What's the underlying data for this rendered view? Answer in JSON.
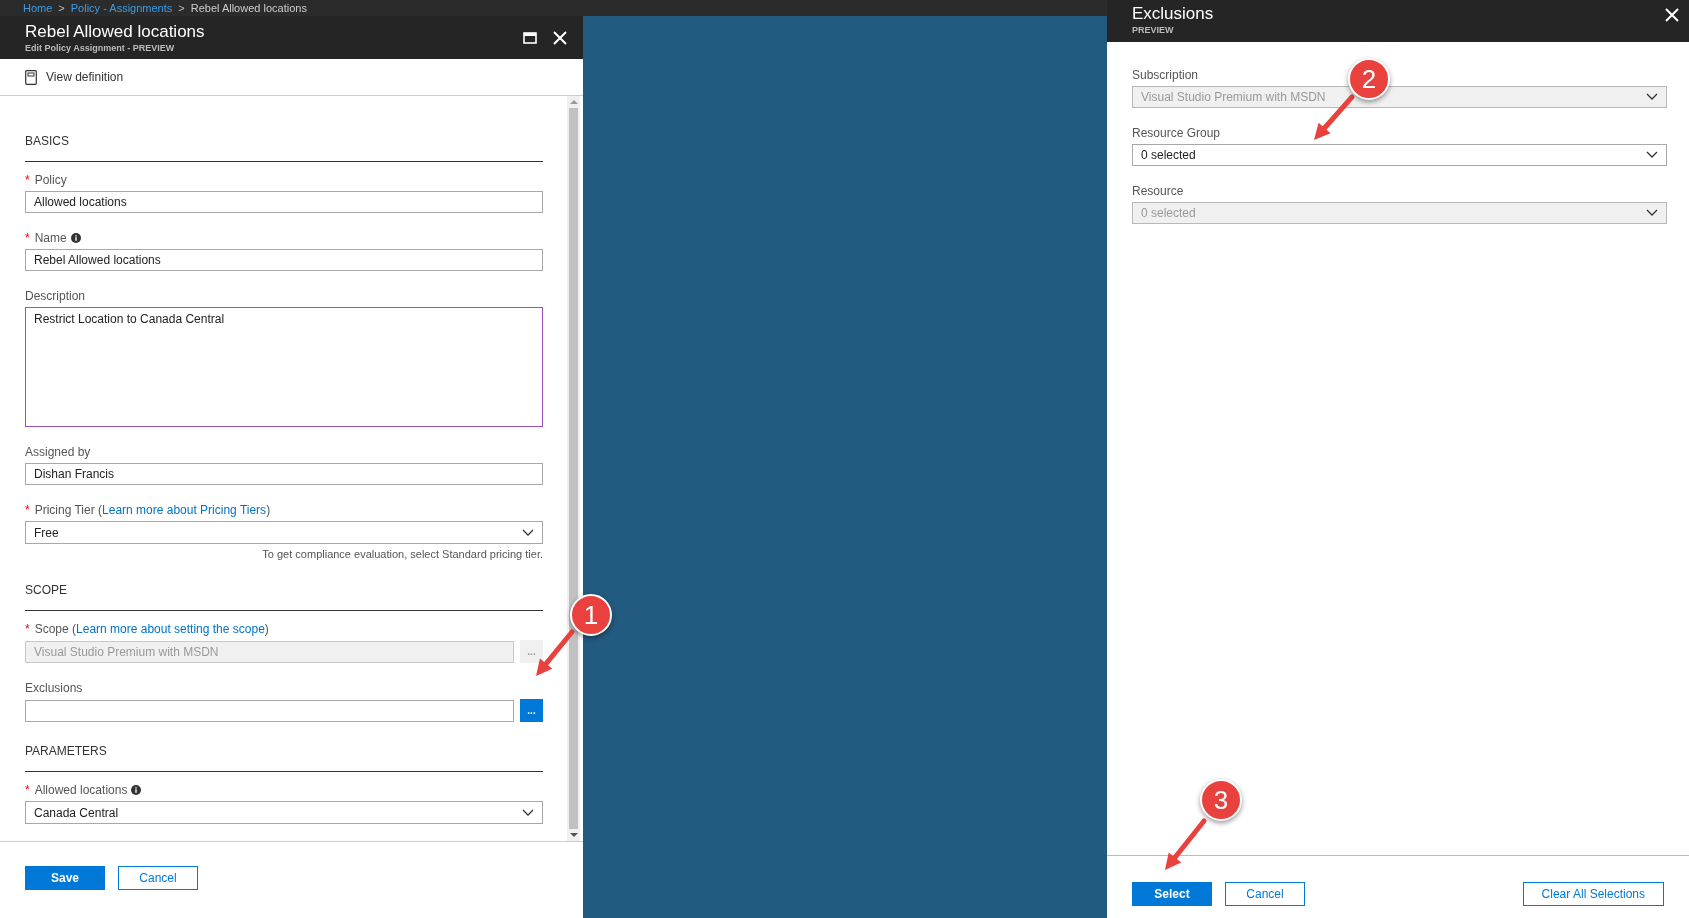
{
  "breadcrumb": [
    {
      "label": "Home",
      "link": true
    },
    {
      "label": "Policy - Assignments",
      "link": true
    },
    {
      "label": "Rebel Allowed locations",
      "link": false
    }
  ],
  "breadcrumb_separator": ">",
  "required_mark": "*",
  "blade": {
    "title": "Rebel Allowed locations",
    "subtitle": "Edit Policy Assignment - PREVIEW"
  },
  "toolbar": {
    "label": "View definition"
  },
  "sections": [
    {
      "heading": "BASICS",
      "fields": [
        {
          "kind": "text",
          "label": "Policy",
          "required": true,
          "info": false,
          "value": "Allowed locations"
        },
        {
          "kind": "text",
          "label": "Name",
          "required": true,
          "info": true,
          "value": "Rebel Allowed locations"
        },
        {
          "kind": "textarea",
          "label": "Description",
          "required": false,
          "info": false,
          "focused": true,
          "value": "Restrict Location to Canada Central"
        },
        {
          "kind": "text",
          "label": "Assigned by",
          "required": false,
          "info": false,
          "value": "Dishan Francis"
        },
        {
          "kind": "select",
          "label": "Pricing Tier (",
          "link": "Learn more about Pricing Tiers",
          "label_after": ")",
          "required": true,
          "info": false,
          "value": "Free",
          "hint": "To get compliance evaluation, select Standard pricing tier."
        }
      ]
    },
    {
      "heading": "SCOPE",
      "fields": [
        {
          "kind": "picker",
          "label": "Scope (",
          "link": "Learn more about setting the scope",
          "label_after": ")",
          "required": true,
          "info": false,
          "disabled": true,
          "value": "Visual Studio Premium with MSDN",
          "button": "..."
        },
        {
          "kind": "picker",
          "label": "Exclusions",
          "required": false,
          "info": false,
          "disabled": false,
          "button": "..."
        }
      ]
    },
    {
      "heading": "PARAMETERS",
      "fields": [
        {
          "kind": "select",
          "label": "Allowed locations",
          "required": true,
          "info": true,
          "value": "Canada Central"
        }
      ]
    }
  ],
  "footer_buttons": [
    {
      "label": "Save",
      "primary": true
    },
    {
      "label": "Cancel",
      "primary": false
    }
  ],
  "exclusions": {
    "title": "Exclusions",
    "subtitle": "PREVIEW",
    "fields": [
      {
        "label": "Subscription",
        "value": "Visual Studio Premium with MSDN",
        "disabled": true
      },
      {
        "label": "Resource Group",
        "value": "0 selected",
        "disabled": false
      },
      {
        "label": "Resource",
        "value": "0 selected",
        "disabled": true
      }
    ],
    "buttons": [
      {
        "label": "Select",
        "primary": true
      },
      {
        "label": "Cancel",
        "primary": false
      },
      {
        "label": "Clear All Selections",
        "primary": false
      }
    ]
  },
  "callouts": [
    "1",
    "2",
    "3"
  ]
}
